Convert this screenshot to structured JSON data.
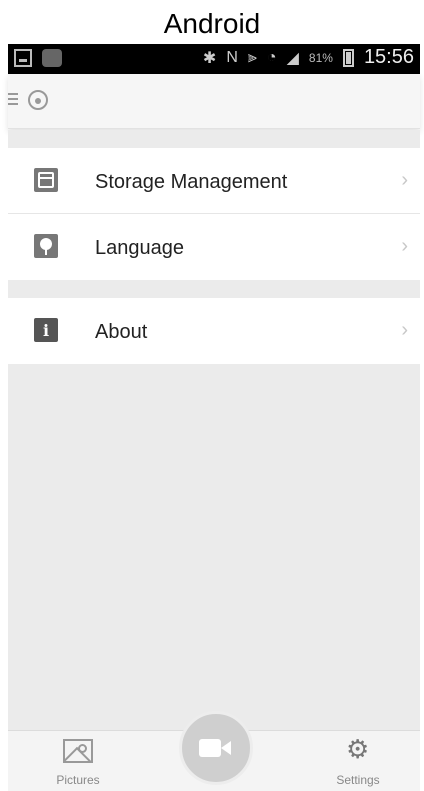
{
  "caption": "Android",
  "status_bar": {
    "battery_percent": "81%",
    "time": "15:56",
    "icons": [
      "screenshot-icon",
      "app-notification-icon",
      "bluetooth-icon",
      "nfc-icon",
      "vibrate-icon",
      "wifi-icon",
      "signal-icon",
      "battery-icon"
    ]
  },
  "toolbar": {
    "icons": [
      "menu-icon",
      "app-logo-icon"
    ]
  },
  "settings": {
    "groups": [
      {
        "items": [
          {
            "label": "Storage Management",
            "icon": "storage-icon"
          },
          {
            "label": "Language",
            "icon": "language-icon"
          }
        ]
      },
      {
        "items": [
          {
            "label": "About",
            "icon": "info-icon"
          }
        ]
      }
    ]
  },
  "tabbar": {
    "pictures_label": "Pictures",
    "settings_label": "Settings",
    "center_icon": "camera-icon"
  }
}
